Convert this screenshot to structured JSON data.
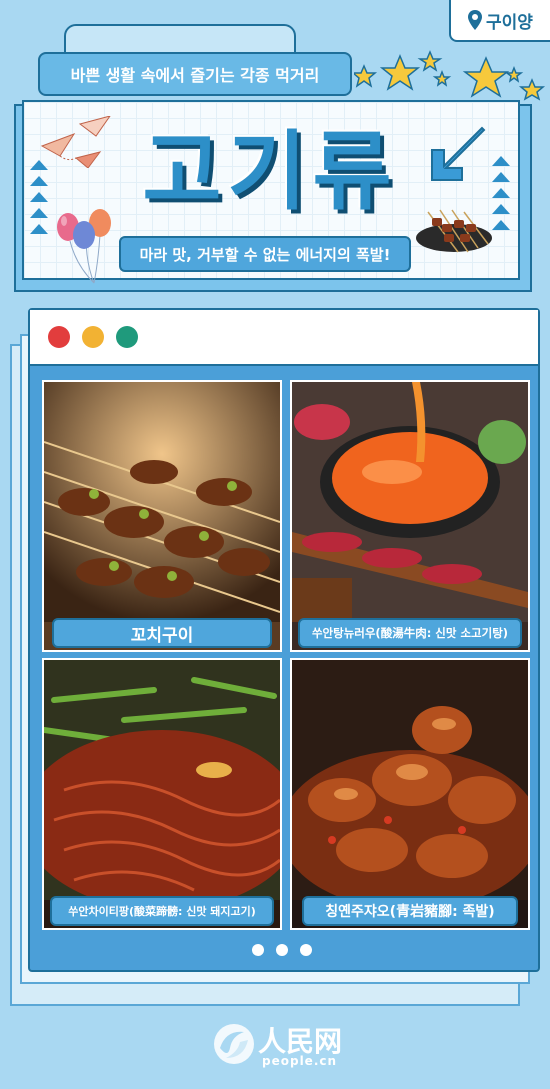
{
  "location_tag": {
    "label": "구이양"
  },
  "header": {
    "subtitle": "바쁜 생활 속에서 즐기는 각종 먹거리",
    "title": "고기류",
    "slogan": "마라 맛, 거부할 수 없는 에너지의 폭발!"
  },
  "window": {
    "dots": [
      "#e23d3d",
      "#f2b233",
      "#1f9a7c"
    ]
  },
  "foods": [
    {
      "caption": "꼬치구이"
    },
    {
      "caption": "쑤안탕뉴러우(酸湯牛肉: 신맛 소고기탕)"
    },
    {
      "caption": "쑤안차이티팡(酸菜蹄髈: 신맛 돼지고기)"
    },
    {
      "caption": "칭옌주쟈오(青岩豬腳: 족발)"
    }
  ],
  "pagination": {
    "count": 3
  },
  "footer": {
    "brand_cn": "人民网",
    "brand_url": "people.cn"
  },
  "colors": {
    "accent": "#1e6f9a",
    "panel_blue": "#4b9fd8",
    "background": "#a9d8f2"
  }
}
